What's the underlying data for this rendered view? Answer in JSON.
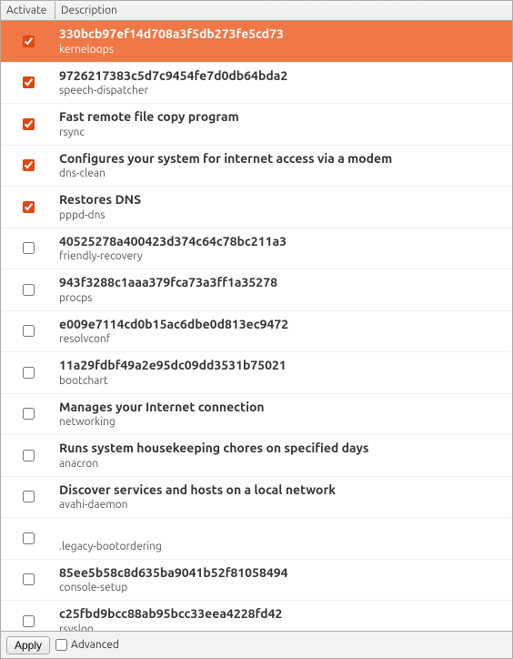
{
  "headers": {
    "activate": "Activate",
    "description": "Description"
  },
  "footer": {
    "apply": "Apply",
    "advanced": "Advanced"
  },
  "items": [
    {
      "title": "330bcb97ef14d708a3f5db273fe5cd73",
      "subtitle": "kerneloops",
      "checked": true,
      "selected": true
    },
    {
      "title": "9726217383c5d7c9454fe7d0db64bda2",
      "subtitle": "speech-dispatcher",
      "checked": true,
      "selected": false
    },
    {
      "title": "Fast remote file copy program",
      "subtitle": "rsync",
      "checked": true,
      "selected": false
    },
    {
      "title": "Configures your system for internet access via a modem",
      "subtitle": "dns-clean",
      "checked": true,
      "selected": false
    },
    {
      "title": "Restores DNS",
      "subtitle": "pppd-dns",
      "checked": true,
      "selected": false
    },
    {
      "title": "40525278a400423d374c64c78bc211a3",
      "subtitle": "friendly-recovery",
      "checked": false,
      "selected": false
    },
    {
      "title": "943f3288c1aaa379fca73a3ff1a35278",
      "subtitle": "procps",
      "checked": false,
      "selected": false
    },
    {
      "title": "e009e7114cd0b15ac6dbe0d813ec9472",
      "subtitle": "resolvconf",
      "checked": false,
      "selected": false
    },
    {
      "title": "11a29fdbf49a2e95dc09dd3531b75021",
      "subtitle": "bootchart",
      "checked": false,
      "selected": false
    },
    {
      "title": "Manages your Internet connection",
      "subtitle": "networking",
      "checked": false,
      "selected": false
    },
    {
      "title": "Runs system housekeeping chores on specified days",
      "subtitle": "anacron",
      "checked": false,
      "selected": false
    },
    {
      "title": "Discover services and hosts on a local network",
      "subtitle": "avahi-daemon",
      "checked": false,
      "selected": false
    },
    {
      "title": "",
      "subtitle": ".legacy-bootordering",
      "checked": false,
      "selected": false
    },
    {
      "title": "85ee5b58c8d635ba9041b52f81058494",
      "subtitle": "console-setup",
      "checked": false,
      "selected": false
    },
    {
      "title": "c25fbd9bcc88ab95bcc33eea4228fd42",
      "subtitle": "rsyslog",
      "checked": false,
      "selected": false
    }
  ]
}
